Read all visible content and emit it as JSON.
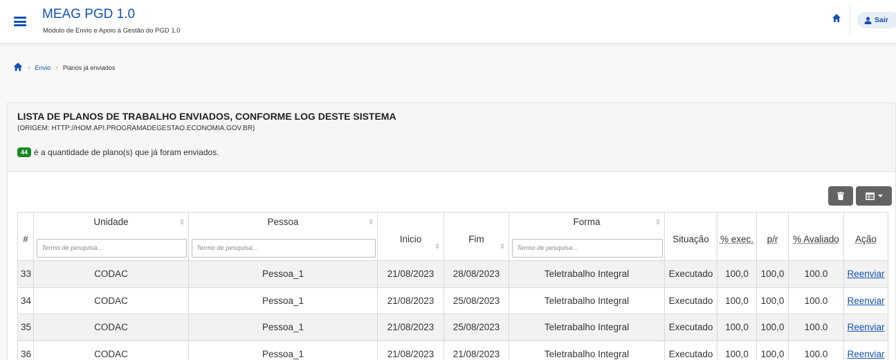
{
  "header": {
    "app_title": "MEAG PGD 1.0",
    "app_subtitle": "Módulo de Envio e Apoio à Gestão do PGD 1.0",
    "logout_label": "Sair"
  },
  "breadcrumb": {
    "items": [
      {
        "label": "Envio"
      },
      {
        "label": "Planos já enviados"
      }
    ]
  },
  "panel": {
    "title": "LISTA DE PLANOS DE TRABALHO ENVIADOS, CONFORME LOG DESTE SISTEMA",
    "origin": "(ORIGEM: HTTP://HOM.API.PROGRAMADEGESTAO.ECONOMIA.GOV.BR)",
    "count": "44",
    "count_text": "é a quantidade de plano(s) que já foram enviados."
  },
  "table": {
    "filter_placeholder": "Termo de pesquisa...",
    "headers": {
      "num": "#",
      "unidade": "Unidade",
      "pessoa": "Pessoa",
      "inicio": "Inicio",
      "fim": "Fim",
      "forma": "Forma",
      "situacao": "Situação",
      "exec": "% exec.",
      "pr": "p/r",
      "avaliado": "% Avaliado",
      "acao": "Ação"
    },
    "rows": [
      {
        "num": "33",
        "unidade": "CODAC",
        "pessoa": "Pessoa_1",
        "inicio": "21/08/2023",
        "fim": "28/08/2023",
        "forma": "Teletrabalho Integral",
        "situacao": "Executado",
        "exec": "100,0",
        "pr": "100,0",
        "avaliado": "100.0",
        "acao": "Reenviar"
      },
      {
        "num": "34",
        "unidade": "CODAC",
        "pessoa": "Pessoa_1",
        "inicio": "21/08/2023",
        "fim": "25/08/2023",
        "forma": "Teletrabalho Integral",
        "situacao": "Executado",
        "exec": "100,0",
        "pr": "100,0",
        "avaliado": "100.0",
        "acao": "Reenviar"
      },
      {
        "num": "35",
        "unidade": "CODAC",
        "pessoa": "Pessoa_1",
        "inicio": "21/08/2023",
        "fim": "25/08/2023",
        "forma": "Teletrabalho Integral",
        "situacao": "Executado",
        "exec": "100,0",
        "pr": "100,0",
        "avaliado": "100.0",
        "acao": "Reenviar"
      },
      {
        "num": "36",
        "unidade": "CODAC",
        "pessoa": "Pessoa_1",
        "inicio": "21/08/2023",
        "fim": "21/08/2023",
        "forma": "Teletrabalho Integral",
        "situacao": "Executado",
        "exec": "100,0",
        "pr": "100,0",
        "avaliado": "100.0",
        "acao": "Reenviar"
      }
    ]
  },
  "icons": {
    "menu": "hamburger-icon",
    "home": "home-icon",
    "user": "user-icon",
    "trash": "trash-icon",
    "columns": "table-columns-icon"
  },
  "colors": {
    "primary": "#1351b4",
    "badge": "#168821",
    "tool_button": "#636363"
  }
}
